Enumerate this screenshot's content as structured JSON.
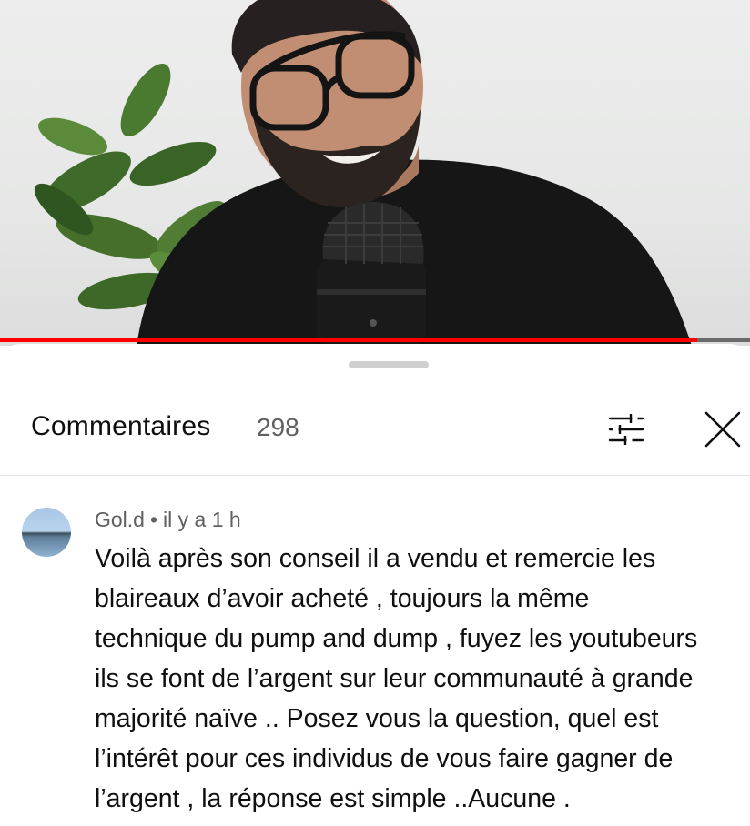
{
  "video": {
    "progress": 0.93
  },
  "comments_panel": {
    "title": "Commentaires",
    "count": "298",
    "icons": {
      "sort": "sort-filter-icon",
      "close": "close-icon"
    }
  },
  "comment": {
    "author": "Gol.d",
    "separator": "•",
    "time": "il y a 1 h",
    "lines": [
      "Voilà après son conseil il a vendu et remercie les",
      "blaireaux d’avoir acheté , toujours la même",
      "technique du pump and dump , fuyez les youtubeurs",
      "ils se font de l’argent sur leur communauté à grande",
      "majorité naïve .. Posez vous la question, quel est",
      "l’intérêt pour ces individus de vous faire gagner de",
      "l’argent , la réponse est simple ..Aucune ."
    ]
  }
}
